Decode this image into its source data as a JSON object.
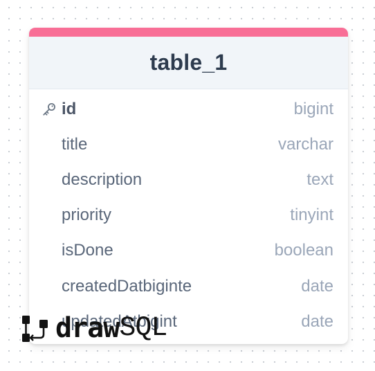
{
  "table": {
    "name": "table_1",
    "accent_color": "#f86e96",
    "columns": [
      {
        "name": "id",
        "type": "bigint",
        "primary_key": true,
        "icon": "key-icon"
      },
      {
        "name": "title",
        "type": "varchar"
      },
      {
        "name": "description",
        "type": "text"
      },
      {
        "name": "priority",
        "type": "tinyint"
      },
      {
        "name": "isDone",
        "type": "boolean"
      },
      {
        "name": "createdDatbiginte",
        "type": "date"
      },
      {
        "name": "updatedAtbigint",
        "type": "date"
      }
    ]
  },
  "watermark": {
    "part1": "draw",
    "part2": "SQL",
    "icon": "drawsql-logo-icon"
  }
}
